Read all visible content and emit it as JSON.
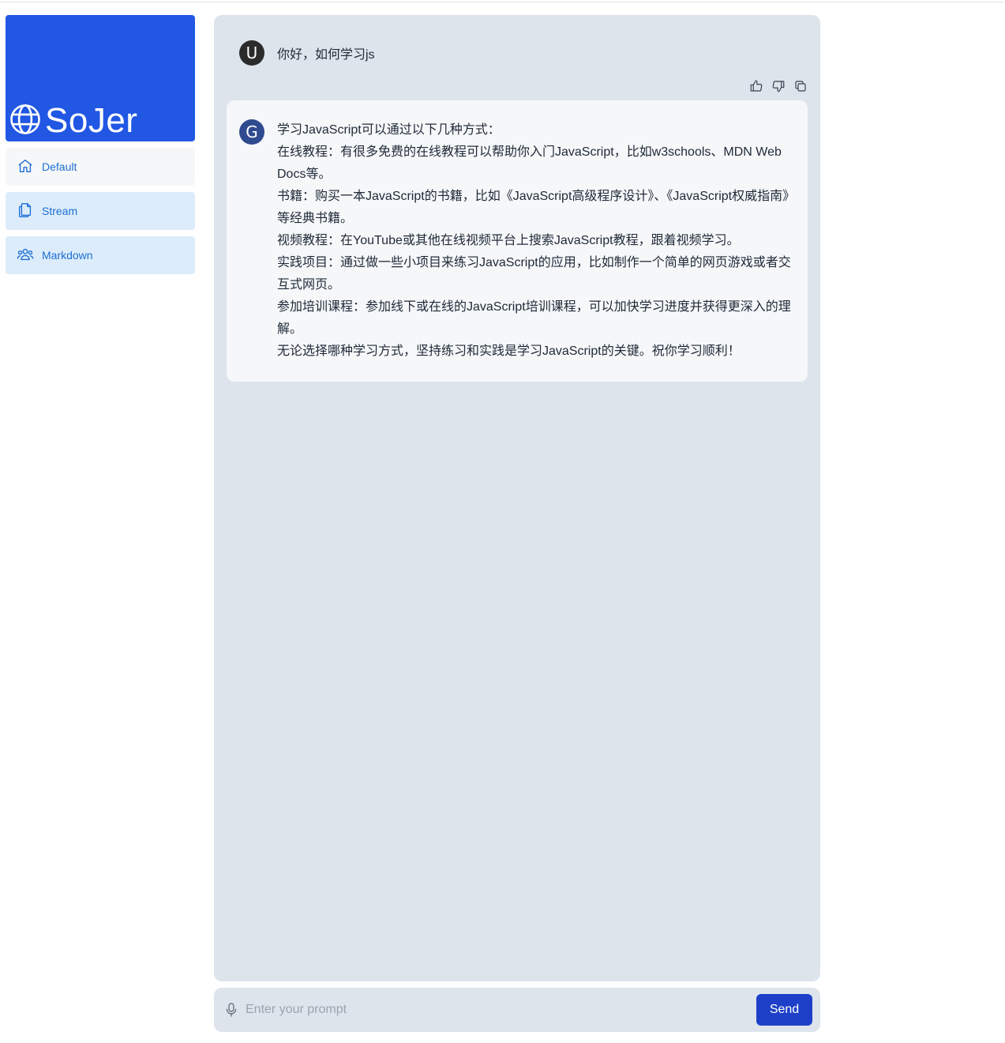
{
  "brand": {
    "name": "SoJer",
    "icon": "globe-icon",
    "color": "#2157e3"
  },
  "sidebar": {
    "items": [
      {
        "label": "Default",
        "icon": "home-icon"
      },
      {
        "label": "Stream",
        "icon": "documents-icon"
      },
      {
        "label": "Markdown",
        "icon": "users-icon"
      }
    ]
  },
  "conversation": {
    "user": {
      "avatar": "U",
      "text": "你好，如何学习js"
    },
    "actions": [
      "thumbs-up-icon",
      "thumbs-down-icon",
      "copy-icon"
    ],
    "assistant": {
      "avatar": "G",
      "lines": [
        "学习JavaScript可以通过以下几种方式：",
        "在线教程：有很多免费的在线教程可以帮助你入门JavaScript，比如w3schools、MDN Web Docs等。",
        "书籍：购买一本JavaScript的书籍，比如《JavaScript高级程序设计》、《JavaScript权威指南》等经典书籍。",
        "视频教程：在YouTube或其他在线视频平台上搜索JavaScript教程，跟着视频学习。",
        "实践项目：通过做一些小项目来练习JavaScript的应用，比如制作一个简单的网页游戏或者交互式网页。",
        "参加培训课程：参加线下或在线的JavaScript培训课程，可以加快学习进度并获得更深入的理解。",
        "无论选择哪种学习方式，坚持练习和实践是学习JavaScript的关键。祝你学习顺利！"
      ]
    }
  },
  "prompt": {
    "placeholder": "Enter your prompt",
    "value": "",
    "send_label": "Send",
    "mic_icon": "microphone-icon"
  },
  "colors": {
    "accent": "#1e40c8",
    "nav_text": "#1d6fd6",
    "panel": "#dde4ec"
  }
}
